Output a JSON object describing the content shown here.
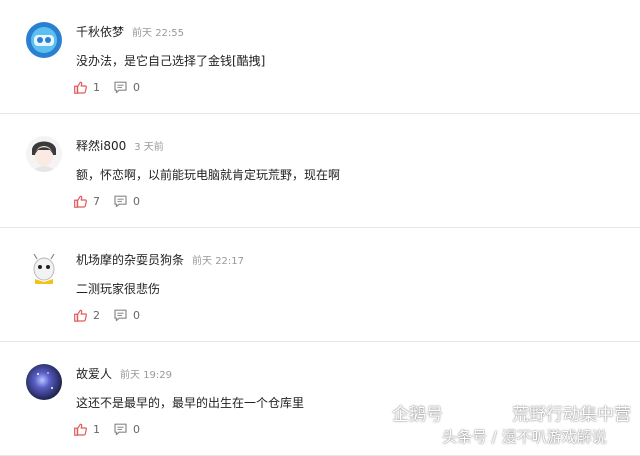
{
  "comments": [
    {
      "user": "千秋依梦",
      "time": "前天 22:55",
      "text": "没办法，是它自己选择了金钱[酷拽]",
      "likes": "1",
      "replies": "0"
    },
    {
      "user": "释然i800",
      "time": "3 天前",
      "text": "额，怀恋啊，以前能玩电脑就肯定玩荒野，现在啊",
      "likes": "7",
      "replies": "0"
    },
    {
      "user": "机场摩的杂耍员狗条",
      "time": "前天 22:17",
      "text": "二测玩家很悲伤",
      "likes": "2",
      "replies": "0"
    },
    {
      "user": "故爱人",
      "time": "前天 19:29",
      "text": "这还不是最早的，最早的出生在一个仓库里",
      "likes": "1",
      "replies": "0"
    }
  ],
  "icons": {
    "like": "thumbs-up-icon",
    "reply": "comment-icon"
  },
  "colors": {
    "like_icon": "#e05a5a",
    "reply_icon": "#888888",
    "divider": "#e6e6e6"
  },
  "watermark": {
    "left": "企鹅号",
    "right": "荒野行动集中营",
    "bottom": "头条号 / 漫不叭游戏解说"
  }
}
